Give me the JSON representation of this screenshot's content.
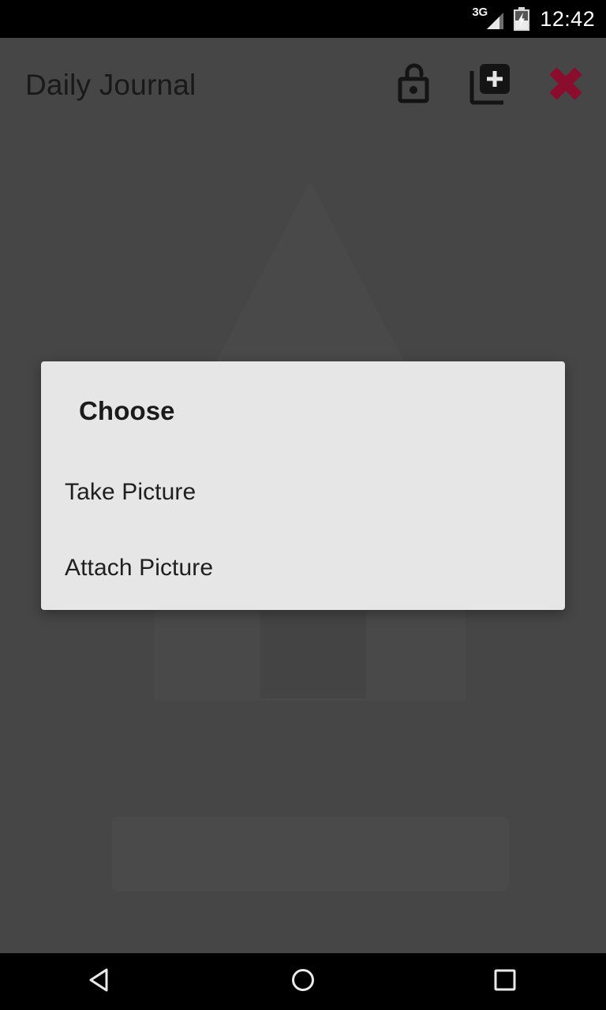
{
  "status_bar": {
    "network_label": "3G",
    "signal_icon": "signal-cellular-icon",
    "battery_icon": "battery-charging-icon",
    "clock": "12:42"
  },
  "app_bar": {
    "title": "Daily Journal",
    "actions": [
      {
        "name": "lock-open-icon",
        "label": "Unlock"
      },
      {
        "name": "library-add-icon",
        "label": "Add Entry"
      },
      {
        "name": "close-x-icon",
        "label": "Close"
      }
    ]
  },
  "dialog": {
    "title": "Choose",
    "items": [
      {
        "label": "Take Picture"
      },
      {
        "label": "Attach Picture"
      }
    ]
  },
  "nav_bar": {
    "back": "back-triangle-icon",
    "home": "home-circle-icon",
    "recents": "recents-square-icon"
  },
  "colors": {
    "scrim": "#565656",
    "dialog_bg": "#E6E6E6",
    "status_bar_bg": "#000000",
    "nav_bar_bg": "#000000",
    "close_icon": "#8B0D2E",
    "title_text": "#191919",
    "dialog_text": "#1F1F1F"
  }
}
